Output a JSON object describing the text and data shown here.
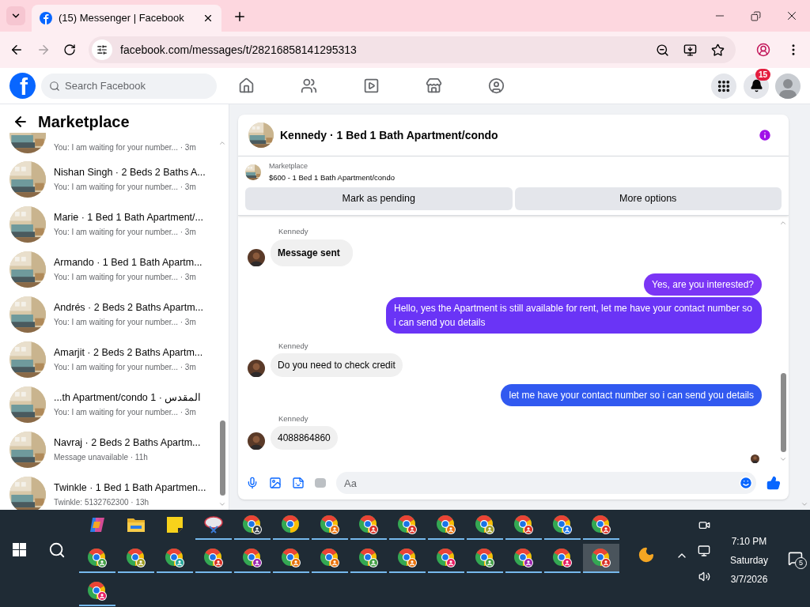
{
  "browser": {
    "tab_title": "(15) Messenger | Facebook",
    "url": "facebook.com/messages/t/28216858141295313",
    "forward_disabled": true
  },
  "facebook": {
    "logo": "f",
    "search_placeholder": "Search Facebook",
    "notification_count": "15"
  },
  "sidebar": {
    "title": "Marketplace",
    "conversations": [
      {
        "preview": "You: I am waiting for your number... · 3m"
      },
      {
        "title": "Nishan Singh · 2 Beds 2 Baths A...",
        "preview": "You: I am waiting for your number... · 3m"
      },
      {
        "title": "Marie · 1 Bed 1 Bath Apartment/...",
        "preview": "You: I am waiting for your number... · 3m"
      },
      {
        "title": "Armando · 1 Bed 1 Bath Apartm...",
        "preview": "You: I am waiting for your number... · 3m"
      },
      {
        "title": "Andrés · 2 Beds 2 Baths Apartm...",
        "preview": "You: I am waiting for your number... · 3m"
      },
      {
        "title": "Amarjit · 2 Beds 2 Baths Apartm...",
        "preview": "You: I am waiting for your number... · 3m"
      },
      {
        "title": "...th Apartment/condo 1 · المقدس",
        "preview": "You: I am waiting for your number... · 3m"
      },
      {
        "title": "Navraj · 2 Beds 2 Baths Apartm...",
        "preview": "Message unavailable · 11h"
      },
      {
        "title": "Twinkle · 1 Bed 1 Bath Apartmen...",
        "preview": "Twinkle: 5132762300 · 13h"
      }
    ]
  },
  "chat": {
    "title": "Kennedy · 1 Bed 1 Bath Apartment/condo",
    "listing": {
      "label": "Marketplace",
      "name": "$600 - 1 Bed 1 Bath Apartment/condo"
    },
    "buttons": [
      "Mark as pending",
      "More options"
    ],
    "messages": [
      {
        "kind": "incoming",
        "sender": "Kennedy",
        "text": "Message sent",
        "bold": true
      },
      {
        "kind": "outgoing",
        "text": "Yes, are you interested?",
        "color": "#7b35f5"
      },
      {
        "kind": "outgoing",
        "text": "Hello, yes the Apartment is still available for rent, let me have your contact number so i can send you details",
        "color": "#6a34f6"
      },
      {
        "kind": "incoming",
        "sender": "Kennedy",
        "text": "Do you need to check credit",
        "bold": false
      },
      {
        "kind": "outgoing",
        "text": "let me have your contact number so i can send you details",
        "color": "#3159f0"
      },
      {
        "kind": "incoming",
        "sender": "Kennedy",
        "text": "4088864860",
        "bold": false
      }
    ],
    "composer_placeholder": "Aa"
  },
  "taskbar": {
    "apps": [
      {
        "kind": "copilot",
        "running": false,
        "selected": false
      },
      {
        "kind": "folder",
        "running": false,
        "selected": false
      },
      {
        "kind": "notes",
        "running": false,
        "selected": false
      },
      {
        "kind": "snip",
        "running": true,
        "selected": false
      },
      {
        "kind": "chrome",
        "color": "#2f3b45",
        "running": true,
        "selected": false
      },
      {
        "kind": "chrome",
        "running": true,
        "selected": false
      },
      {
        "kind": "chrome",
        "color": "#e8710a",
        "running": true,
        "selected": false
      },
      {
        "kind": "chrome",
        "color": "#d93025",
        "running": true,
        "selected": false
      },
      {
        "kind": "chrome",
        "color": "#d93025",
        "running": true,
        "selected": false
      },
      {
        "kind": "chrome",
        "color": "#e8710a",
        "running": true,
        "selected": false
      },
      {
        "kind": "chrome",
        "color": "#9e9d24",
        "running": true,
        "selected": false
      },
      {
        "kind": "chrome",
        "color": "#d93025",
        "running": true,
        "selected": false
      },
      {
        "kind": "chrome",
        "color": "#1a73e8",
        "running": true,
        "selected": false
      },
      {
        "kind": "chrome",
        "color": "#d93025",
        "running": true,
        "selected": false
      },
      {
        "kind": "chrome",
        "color": "#43a047",
        "running": true,
        "selected": false
      },
      {
        "kind": "chrome",
        "color": "#9e9d24",
        "running": true,
        "selected": false
      },
      {
        "kind": "chrome",
        "color": "#26a69a",
        "running": true,
        "selected": false
      },
      {
        "kind": "chrome",
        "color": "#d93025",
        "running": true,
        "selected": false
      },
      {
        "kind": "chrome",
        "color": "#9c27b0",
        "running": true,
        "selected": false
      },
      {
        "kind": "chrome",
        "color": "#e8710a",
        "running": true,
        "selected": false
      },
      {
        "kind": "chrome",
        "color": "#e8710a",
        "running": true,
        "selected": false
      },
      {
        "kind": "chrome",
        "color": "#43a047",
        "running": true,
        "selected": false
      },
      {
        "kind": "chrome",
        "color": "#e8710a",
        "running": true,
        "selected": false
      },
      {
        "kind": "chrome",
        "color": "#e91e63",
        "running": true,
        "selected": false
      },
      {
        "kind": "chrome",
        "color": "#43a047",
        "running": true,
        "selected": false
      },
      {
        "kind": "chrome",
        "color": "#9c27b0",
        "running": true,
        "selected": false
      },
      {
        "kind": "chrome",
        "color": "#e91e63",
        "running": true,
        "selected": false
      },
      {
        "kind": "chrome",
        "color": "#d93025",
        "running": true,
        "selected": true
      },
      {
        "kind": "chrome",
        "color": "#e91e63",
        "running": true,
        "selected": false
      }
    ],
    "time": "7:10 PM",
    "day": "Saturday",
    "date": "3/7/2026",
    "notification_count": "5"
  }
}
